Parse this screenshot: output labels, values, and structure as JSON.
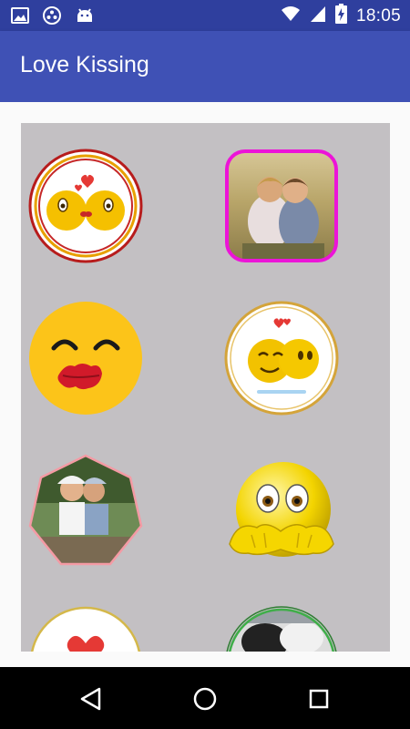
{
  "status_bar": {
    "time": "18:05",
    "left_icons": [
      "image-icon",
      "circle-dots-icon",
      "android-icon"
    ],
    "right_icons": [
      "wifi-icon",
      "signal-icon",
      "battery-charging-icon"
    ]
  },
  "app_bar": {
    "title": "Love Kissing",
    "color": "#3f51b5"
  },
  "grid": {
    "background": "#c3c0c3",
    "items": [
      {
        "name": "kissing-emoji-circle-tile",
        "icon": "kissing-emojis"
      },
      {
        "name": "kids-kissing-photo-tile",
        "icon": "photo-kids-kiss"
      },
      {
        "name": "kiss-lips-emoji-tile",
        "icon": "kiss-lips-emoji"
      },
      {
        "name": "cheek-kiss-emoji-tile",
        "icon": "cheek-kiss-emojis"
      },
      {
        "name": "kids-bench-photo-tile",
        "icon": "photo-kids-bench"
      },
      {
        "name": "hands-over-mouth-emoji-tile",
        "icon": "shy-emoji"
      },
      {
        "name": "heart-circle-tile",
        "icon": "heart-circle"
      },
      {
        "name": "photo-circle-tile",
        "icon": "photo-circle"
      }
    ]
  },
  "nav_bar": {
    "buttons": [
      "back-icon",
      "home-icon",
      "recents-icon"
    ]
  }
}
